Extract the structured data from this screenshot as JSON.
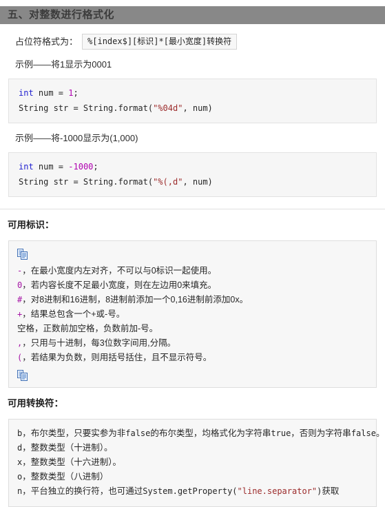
{
  "section": {
    "heading": "五、对整数进行格式化"
  },
  "placeholder": {
    "label": "占位符格式为：",
    "format": "%[index$][标识]*[最小宽度]转换符"
  },
  "examples": [
    {
      "caption": "示例——将1显示为0001",
      "code": [
        {
          "parts": [
            {
              "t": "int",
              "c": "kw"
            },
            {
              "t": " num = ",
              "c": "plain"
            },
            {
              "t": "1",
              "c": "num"
            },
            {
              "t": ";",
              "c": "plain"
            }
          ]
        },
        {
          "parts": [
            {
              "t": "String str = String.format(",
              "c": "plain"
            },
            {
              "t": "\"%04d\"",
              "c": "str"
            },
            {
              "t": ", num)",
              "c": "plain"
            }
          ]
        }
      ]
    },
    {
      "caption": "示例——将-1000显示为(1,000)",
      "code": [
        {
          "parts": [
            {
              "t": "int",
              "c": "kw"
            },
            {
              "t": " num = ",
              "c": "plain"
            },
            {
              "t": "-1000",
              "c": "num"
            },
            {
              "t": ";",
              "c": "plain"
            }
          ]
        },
        {
          "parts": [
            {
              "t": "String str = String.format(",
              "c": "plain"
            },
            {
              "t": "\"%(,d\"",
              "c": "str"
            },
            {
              "t": ", num)",
              "c": "plain"
            }
          ]
        }
      ]
    }
  ],
  "flags": {
    "heading": "可用标识：",
    "copy_icon_top": "copy-icon",
    "copy_icon_bottom": "copy-icon",
    "items": [
      {
        "key": "-",
        "key_style": "mono",
        "text": "，在最小宽度内左对齐，不可以与0标识一起使用。"
      },
      {
        "key": "0",
        "key_style": "mono",
        "text": "，若内容长度不足最小宽度，则在左边用0来填充。"
      },
      {
        "key": "#",
        "key_style": "mono",
        "text": "，对8进制和16进制，8进制前添加一个0,16进制前添加0x。"
      },
      {
        "key": "+",
        "key_style": "mono",
        "text": "，结果总包含一个+或-号。"
      },
      {
        "key": "空格",
        "key_style": "plain",
        "text": "，正数前加空格，负数前加-号。"
      },
      {
        "key": ",",
        "key_style": "mono",
        "text": "，只用与十进制，每3位数字间用,分隔。"
      },
      {
        "key": "(",
        "key_style": "mono",
        "text": "，若结果为负数，则用括号括住，且不显示符号。"
      }
    ]
  },
  "converters": {
    "heading": "可用转换符：",
    "items": [
      {
        "key": "b",
        "parts": [
          {
            "t": "，布尔类型，只要实参为非",
            "c": "cn"
          },
          {
            "t": "false",
            "c": "mono"
          },
          {
            "t": "的布尔类型，均格式化为字符串",
            "c": "cn"
          },
          {
            "t": "true",
            "c": "mono"
          },
          {
            "t": "，否则为字符串",
            "c": "cn"
          },
          {
            "t": "false",
            "c": "mono"
          },
          {
            "t": "。",
            "c": "cn"
          }
        ]
      },
      {
        "key": "d",
        "parts": [
          {
            "t": "，整数类型（十进制）。",
            "c": "cn"
          }
        ]
      },
      {
        "key": "x",
        "parts": [
          {
            "t": "，整数类型（十六进制）。",
            "c": "cn"
          }
        ]
      },
      {
        "key": "o",
        "parts": [
          {
            "t": "，整数类型（八进制）",
            "c": "cn"
          }
        ]
      },
      {
        "key": "n",
        "parts": [
          {
            "t": "，平台独立的换行符，也可通过",
            "c": "cn"
          },
          {
            "t": "System.getProperty(",
            "c": "mono"
          },
          {
            "t": "\"line.separator\"",
            "c": "mono-str"
          },
          {
            "t": ")",
            "c": "mono"
          },
          {
            "t": "获取",
            "c": "cn"
          }
        ]
      }
    ]
  }
}
